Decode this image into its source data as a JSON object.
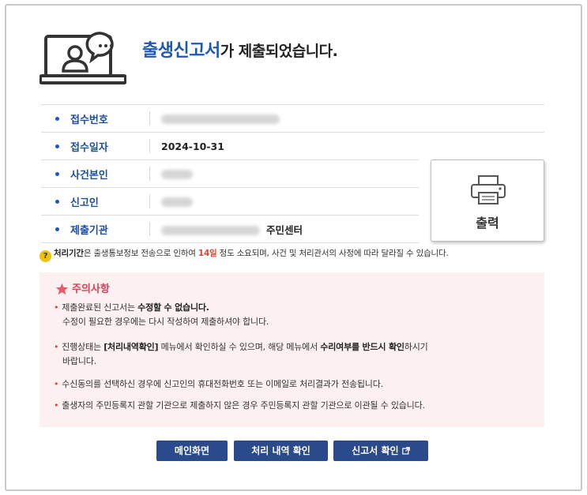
{
  "header": {
    "title_accent": "출생신고서",
    "title_rest": "가 제출되었습니다."
  },
  "info": {
    "rows": [
      {
        "label": "접수번호",
        "value": ""
      },
      {
        "label": "접수일자",
        "value": "2024-10-31"
      },
      {
        "label": "사건본인",
        "value": ""
      },
      {
        "label": "신고인",
        "value": ""
      },
      {
        "label": "제출기관",
        "value": "주민센터"
      }
    ]
  },
  "print_button": {
    "label": "출력"
  },
  "notice": {
    "prefix": "처리기간",
    "mid": "은 출생통보정보 전송으로 인하여 ",
    "days": "14일",
    "suffix": " 정도 소요되며, 사건 및 처리관서의 사정에 따라 달라질 수 있습니다."
  },
  "caution": {
    "title": "주의사항",
    "item1_a": "제출완료된 신고서는 ",
    "item1_b": "수정할 수 없습니다.",
    "item1_c": "수정이 필요한 경우에는 다시 작성하여 제출하셔야 합니다.",
    "item2_a": "진행상태는 ",
    "item2_b": "[처리내역확인]",
    "item2_c": " 메뉴에서 확인하실 수 있으며, 해당 메뉴에서 ",
    "item2_d": "수리여부를 반드시 확인",
    "item2_e": "하시기",
    "item2_f": "바랍니다.",
    "item3": "수신동의를 선택하신 경우에 신고인의 휴대전화번호 또는 이메일로 처리결과가 전송됩니다.",
    "item4": "출생자의 주민등록지 관할 기관으로 제출하지 않은 경우 주민등록지 관할 기관으로 이관될 수 있습니다."
  },
  "buttons": {
    "main": "메인화면",
    "history": "처리 내역 확인",
    "report": "신고서 확인"
  },
  "colors": {
    "accent_blue": "#1d58b8",
    "button_navy": "#2a4a8c",
    "caution_bg": "#fdf0f0",
    "warning_red": "#e0452b"
  }
}
